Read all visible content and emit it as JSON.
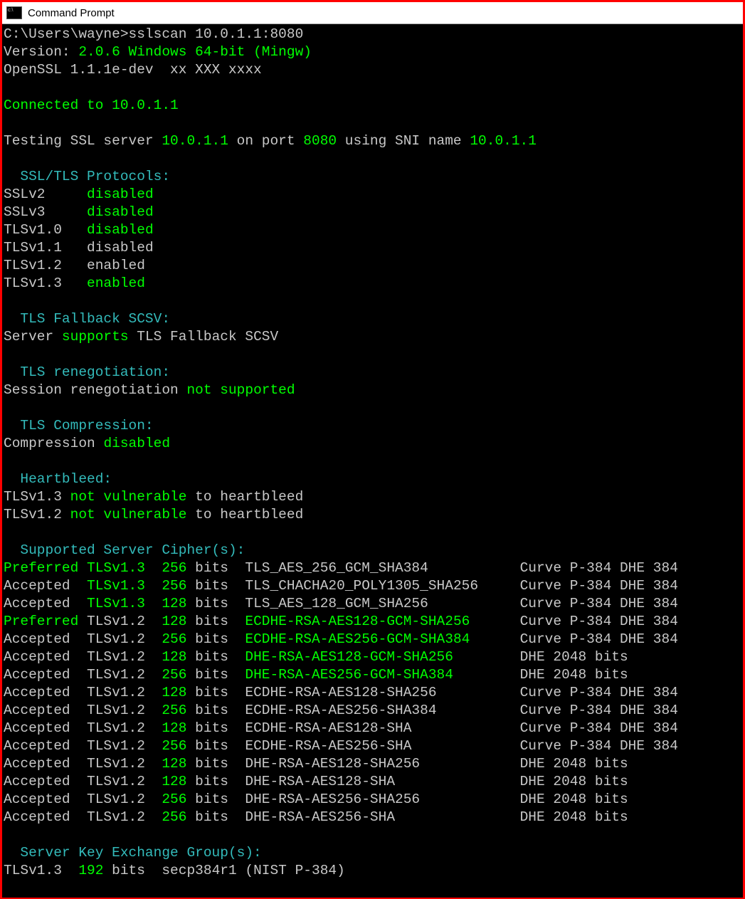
{
  "window": {
    "title": "Command Prompt"
  },
  "prompt": {
    "path": "C:\\Users\\wayne>",
    "cmd": "sslscan 10.0.1.1:8080"
  },
  "version": {
    "label": "Version:",
    "value": "2.0.6 Windows 64-bit (Mingw)"
  },
  "openssl": "OpenSSL 1.1.1e-dev  xx XXX xxxx",
  "connected": {
    "label": "Connected to ",
    "ip": "10.0.1.1"
  },
  "testing": {
    "p1": "Testing SSL server ",
    "ip": "10.0.1.1",
    "p2": " on port ",
    "port": "8080",
    "p3": " using SNI name ",
    "sni": "10.0.1.1"
  },
  "sections": {
    "protocols": "SSL/TLS Protocols:",
    "fallback": "TLS Fallback SCSV:",
    "reneg": "TLS renegotiation:",
    "compress": "TLS Compression:",
    "heartbleed": "Heartbleed:",
    "ciphers": "Supported Server Cipher(s):",
    "kex": "Server Key Exchange Group(s):"
  },
  "protocols": [
    {
      "name": "SSLv2",
      "pad": "     ",
      "status": "disabled",
      "color": "green"
    },
    {
      "name": "SSLv3",
      "pad": "     ",
      "status": "disabled",
      "color": "green"
    },
    {
      "name": "TLSv1.0",
      "pad": "   ",
      "status": "disabled",
      "color": "green"
    },
    {
      "name": "TLSv1.1",
      "pad": "   ",
      "status": "disabled",
      "color": "grey"
    },
    {
      "name": "TLSv1.2",
      "pad": "   ",
      "status": "enabled",
      "color": "grey"
    },
    {
      "name": "TLSv1.3",
      "pad": "   ",
      "status": "enabled",
      "color": "green"
    }
  ],
  "fallback_line": {
    "p1": "Server ",
    "status": "supports",
    "p2": " TLS Fallback SCSV"
  },
  "reneg_line": {
    "p1": "Session renegotiation ",
    "status": "not supported"
  },
  "compress_line": {
    "p1": "Compression ",
    "status": "disabled"
  },
  "heartbleed_lines": [
    {
      "proto": "TLSv1.3 ",
      "status": "not vulnerable",
      "tail": " to heartbleed"
    },
    {
      "proto": "TLSv1.2 ",
      "status": "not vulnerable",
      "tail": " to heartbleed"
    }
  ],
  "ciphers": [
    {
      "st": "Preferred",
      "stc": "green",
      "proto": "TLSv1.3",
      "pc": "green",
      "bits": "256",
      "cipher": "TLS_AES_256_GCM_SHA384           ",
      "cc": "grey",
      "extra": "Curve P-384 DHE 384"
    },
    {
      "st": "Accepted ",
      "stc": "grey",
      "proto": "TLSv1.3",
      "pc": "green",
      "bits": "256",
      "cipher": "TLS_CHACHA20_POLY1305_SHA256     ",
      "cc": "grey",
      "extra": "Curve P-384 DHE 384"
    },
    {
      "st": "Accepted ",
      "stc": "grey",
      "proto": "TLSv1.3",
      "pc": "green",
      "bits": "128",
      "cipher": "TLS_AES_128_GCM_SHA256           ",
      "cc": "grey",
      "extra": "Curve P-384 DHE 384"
    },
    {
      "st": "Preferred",
      "stc": "green",
      "proto": "TLSv1.2",
      "pc": "grey",
      "bits": "128",
      "cipher": "ECDHE-RSA-AES128-GCM-SHA256      ",
      "cc": "green",
      "extra": "Curve P-384 DHE 384"
    },
    {
      "st": "Accepted ",
      "stc": "grey",
      "proto": "TLSv1.2",
      "pc": "grey",
      "bits": "256",
      "cipher": "ECDHE-RSA-AES256-GCM-SHA384      ",
      "cc": "green",
      "extra": "Curve P-384 DHE 384"
    },
    {
      "st": "Accepted ",
      "stc": "grey",
      "proto": "TLSv1.2",
      "pc": "grey",
      "bits": "128",
      "cipher": "DHE-RSA-AES128-GCM-SHA256        ",
      "cc": "green",
      "extra": "DHE 2048 bits"
    },
    {
      "st": "Accepted ",
      "stc": "grey",
      "proto": "TLSv1.2",
      "pc": "grey",
      "bits": "256",
      "cipher": "DHE-RSA-AES256-GCM-SHA384        ",
      "cc": "green",
      "extra": "DHE 2048 bits"
    },
    {
      "st": "Accepted ",
      "stc": "grey",
      "proto": "TLSv1.2",
      "pc": "grey",
      "bits": "128",
      "cipher": "ECDHE-RSA-AES128-SHA256          ",
      "cc": "grey",
      "extra": "Curve P-384 DHE 384"
    },
    {
      "st": "Accepted ",
      "stc": "grey",
      "proto": "TLSv1.2",
      "pc": "grey",
      "bits": "256",
      "cipher": "ECDHE-RSA-AES256-SHA384          ",
      "cc": "grey",
      "extra": "Curve P-384 DHE 384"
    },
    {
      "st": "Accepted ",
      "stc": "grey",
      "proto": "TLSv1.2",
      "pc": "grey",
      "bits": "128",
      "cipher": "ECDHE-RSA-AES128-SHA             ",
      "cc": "grey",
      "extra": "Curve P-384 DHE 384"
    },
    {
      "st": "Accepted ",
      "stc": "grey",
      "proto": "TLSv1.2",
      "pc": "grey",
      "bits": "256",
      "cipher": "ECDHE-RSA-AES256-SHA             ",
      "cc": "grey",
      "extra": "Curve P-384 DHE 384"
    },
    {
      "st": "Accepted ",
      "stc": "grey",
      "proto": "TLSv1.2",
      "pc": "grey",
      "bits": "128",
      "cipher": "DHE-RSA-AES128-SHA256            ",
      "cc": "grey",
      "extra": "DHE 2048 bits"
    },
    {
      "st": "Accepted ",
      "stc": "grey",
      "proto": "TLSv1.2",
      "pc": "grey",
      "bits": "128",
      "cipher": "DHE-RSA-AES128-SHA               ",
      "cc": "grey",
      "extra": "DHE 2048 bits"
    },
    {
      "st": "Accepted ",
      "stc": "grey",
      "proto": "TLSv1.2",
      "pc": "grey",
      "bits": "256",
      "cipher": "DHE-RSA-AES256-SHA256            ",
      "cc": "grey",
      "extra": "DHE 2048 bits"
    },
    {
      "st": "Accepted ",
      "stc": "grey",
      "proto": "TLSv1.2",
      "pc": "grey",
      "bits": "256",
      "cipher": "DHE-RSA-AES256-SHA               ",
      "cc": "grey",
      "extra": "DHE 2048 bits"
    }
  ],
  "kex_line": {
    "proto": "TLSv1.3  ",
    "bits": "192",
    "label": " bits  ",
    "curve": "secp384r1 (NIST P-384)"
  }
}
